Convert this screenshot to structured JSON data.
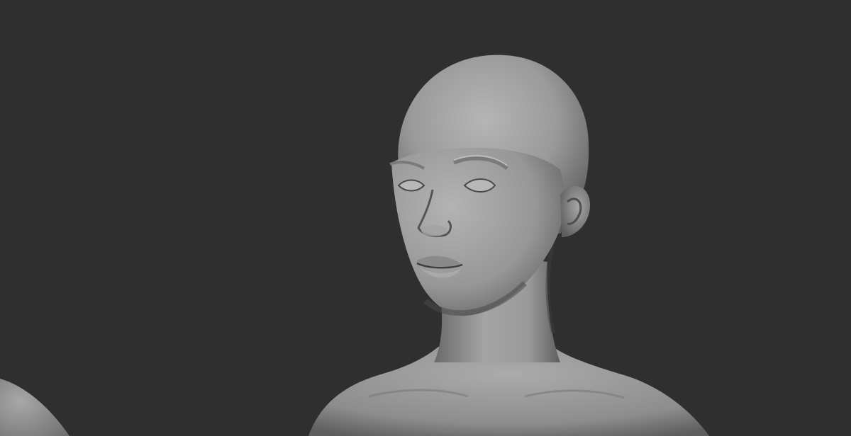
{
  "viewport": {
    "background": "#2f2f2f"
  },
  "model": {
    "material": "grey clay",
    "base_color": "#8e8e8e",
    "highlight_color": "#b8b8b8",
    "shadow_color": "#4a4a4a"
  }
}
